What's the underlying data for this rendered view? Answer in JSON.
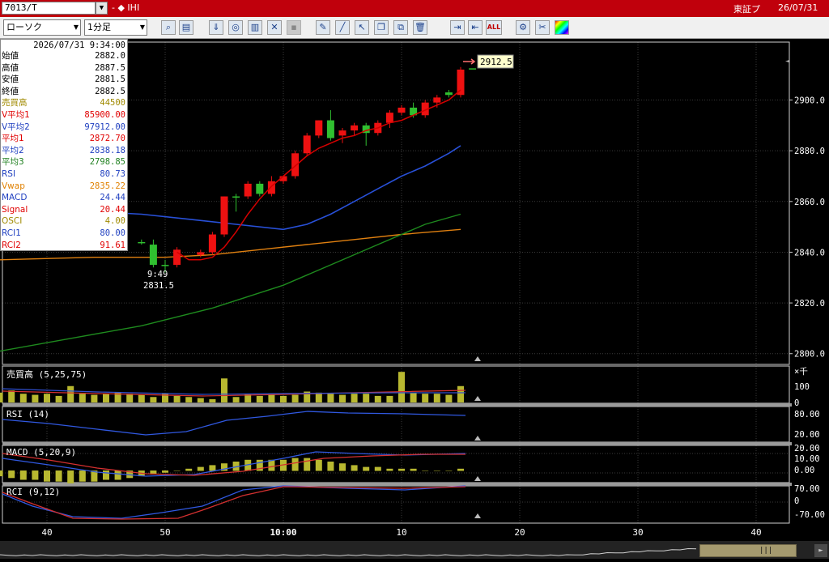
{
  "titlebar": {
    "symbol": "7013/T",
    "symbol_dropdown_arrow": "▼",
    "name": "- ◆ IHI",
    "exchange": "東証プ",
    "date": "26/07/31"
  },
  "toolbar": {
    "chart_type": "ローソク",
    "interval": "1分足",
    "dropdown_arrow": "▼",
    "icons": [
      "zoom-icon",
      "layout-icon",
      "download-icon",
      "search-doc-icon",
      "bar-chart-icon",
      "indicator-icon",
      "disabled-icon",
      "pencil-icon",
      "draw-line-icon",
      "cursor-icon",
      "window-icon",
      "copy-icon",
      "trash-icon",
      "scale-in-icon",
      "scale-out-icon",
      "all-icon",
      "settings-icon",
      "tools-icon",
      "color-icon"
    ],
    "all_label": "ALL"
  },
  "info_panel": {
    "timestamp": "2026/07/31  9:34:00",
    "rows": [
      {
        "label": "始値",
        "value": "2882.0",
        "color": "#000000"
      },
      {
        "label": "高値",
        "value": "2887.5",
        "color": "#000000"
      },
      {
        "label": "安値",
        "value": "2881.5",
        "color": "#000000"
      },
      {
        "label": "終値",
        "value": "2882.5",
        "color": "#000000"
      },
      {
        "label": "売買高",
        "value": "44500",
        "color": "#a08a00"
      },
      {
        "label": "V平均1",
        "value": "85900.00",
        "color": "#e00000"
      },
      {
        "label": "V平均2",
        "value": "97912.00",
        "color": "#2040c0"
      },
      {
        "label": "平均1",
        "value": "2872.70",
        "color": "#e00000"
      },
      {
        "label": "平均2",
        "value": "2838.18",
        "color": "#2040c0"
      },
      {
        "label": "平均3",
        "value": "2798.85",
        "color": "#208020"
      },
      {
        "label": "RSI",
        "value": "80.73",
        "color": "#2040c0"
      },
      {
        "label": "Vwap",
        "value": "2835.22",
        "color": "#e08000"
      },
      {
        "label": "MACD",
        "value": "24.44",
        "color": "#2040c0"
      },
      {
        "label": "Signal",
        "value": "20.44",
        "color": "#e00000"
      },
      {
        "label": "OSCI",
        "value": "4.00",
        "color": "#a08a00"
      },
      {
        "label": "RCI1",
        "value": "80.00",
        "color": "#2040c0"
      },
      {
        "label": "RCI2",
        "value": "91.61",
        "color": "#e00000"
      }
    ]
  },
  "chart_data": {
    "type": "candlestick",
    "price_axis": {
      "ticks": [
        2900,
        2880,
        2860,
        2840,
        2820,
        2800
      ],
      "tick_labels": [
        "2900.0",
        "2880.0",
        "2860.0",
        "2840.0",
        "2820.0",
        "2800.0"
      ],
      "range": [
        2798,
        2919
      ]
    },
    "time_axis": {
      "labels": [
        "40",
        "50",
        "10:00",
        "10",
        "20",
        "30",
        "40"
      ],
      "minutes": [
        -20,
        -10,
        0,
        10,
        20,
        30,
        40
      ],
      "range": [
        -24.3,
        40.4
      ]
    },
    "candles": [
      {
        "t": -12,
        "o": 2844,
        "h": 2845,
        "l": 2843,
        "c": 2844
      },
      {
        "t": -11,
        "o": 2843,
        "h": 2845,
        "l": 2834,
        "c": 2835
      },
      {
        "t": -10,
        "o": 2835,
        "h": 2837,
        "l": 2832,
        "c": 2835
      },
      {
        "t": -9,
        "o": 2835,
        "h": 2842,
        "l": 2834,
        "c": 2841
      },
      {
        "t": -7,
        "o": 2839,
        "h": 2841,
        "l": 2838,
        "c": 2840
      },
      {
        "t": -6,
        "o": 2840,
        "h": 2848,
        "l": 2839,
        "c": 2847
      },
      {
        "t": -5,
        "o": 2847,
        "h": 2862,
        "l": 2846,
        "c": 2862
      },
      {
        "t": -4,
        "o": 2862,
        "h": 2863,
        "l": 2856,
        "c": 2862
      },
      {
        "t": -3,
        "o": 2862,
        "h": 2868,
        "l": 2861,
        "c": 2867
      },
      {
        "t": -2,
        "o": 2867,
        "h": 2868,
        "l": 2862,
        "c": 2863
      },
      {
        "t": -1,
        "o": 2863,
        "h": 2870,
        "l": 2862,
        "c": 2868
      },
      {
        "t": 0,
        "o": 2868,
        "h": 2870,
        "l": 2867,
        "c": 2870
      },
      {
        "t": 1,
        "o": 2870,
        "h": 2880,
        "l": 2869,
        "c": 2879
      },
      {
        "t": 2,
        "o": 2879,
        "h": 2887,
        "l": 2878,
        "c": 2886
      },
      {
        "t": 3,
        "o": 2886,
        "h": 2892,
        "l": 2885,
        "c": 2892
      },
      {
        "t": 4,
        "o": 2892,
        "h": 2896,
        "l": 2884,
        "c": 2885
      },
      {
        "t": 5,
        "o": 2886,
        "h": 2889,
        "l": 2883,
        "c": 2888
      },
      {
        "t": 6,
        "o": 2888,
        "h": 2891,
        "l": 2886,
        "c": 2890
      },
      {
        "t": 7,
        "o": 2890,
        "h": 2891,
        "l": 2882,
        "c": 2887
      },
      {
        "t": 8,
        "o": 2887,
        "h": 2892,
        "l": 2886,
        "c": 2891
      },
      {
        "t": 9,
        "o": 2891,
        "h": 2896,
        "l": 2889,
        "c": 2895
      },
      {
        "t": 10,
        "o": 2895,
        "h": 2898,
        "l": 2894,
        "c": 2897
      },
      {
        "t": 11,
        "o": 2897,
        "h": 2899,
        "l": 2893,
        "c": 2894
      },
      {
        "t": 12,
        "o": 2894,
        "h": 2900,
        "l": 2893,
        "c": 2899
      },
      {
        "t": 13,
        "o": 2899,
        "h": 2902,
        "l": 2897,
        "c": 2901
      },
      {
        "t": 14,
        "o": 2903,
        "h": 2904,
        "l": 2901,
        "c": 2902
      },
      {
        "t": 15,
        "o": 2902,
        "h": 2913,
        "l": 2901,
        "c": 2912
      },
      {
        "t": 16,
        "o": 2912.5,
        "h": 2912.5,
        "l": 2912.5,
        "c": 2912.5
      }
    ],
    "ma1": {
      "color": "#d40000",
      "t": [
        -9,
        -8,
        -7,
        -6,
        -5,
        -4,
        -3,
        -2,
        -1,
        0,
        1,
        2,
        3,
        4,
        5,
        6,
        7,
        8,
        9,
        10,
        11,
        12,
        13,
        14,
        15
      ],
      "v": [
        2840,
        2837,
        2837,
        2838,
        2842,
        2848,
        2855,
        2861,
        2866,
        2870,
        2874,
        2878,
        2881,
        2883,
        2885,
        2886,
        2888,
        2889,
        2891,
        2892,
        2894,
        2896,
        2898,
        2900,
        2904
      ]
    },
    "ma2": {
      "color": "#2850d8",
      "t": [
        -24,
        -20,
        -16,
        -12,
        -8,
        -4,
        0,
        2,
        4,
        6,
        8,
        10,
        12,
        14,
        15
      ],
      "v": [
        2854,
        2855,
        2856,
        2855,
        2853,
        2851,
        2849,
        2851,
        2855,
        2860,
        2865,
        2870,
        2874,
        2879,
        2882
      ]
    },
    "ma3": {
      "color": "#1e8a1e",
      "t": [
        -24,
        -18,
        -12,
        -6,
        0,
        4,
        8,
        12,
        15
      ],
      "v": [
        2801,
        2806,
        2811,
        2818,
        2827,
        2835,
        2843,
        2851,
        2855
      ]
    },
    "vwap": {
      "color": "#e08010",
      "t": [
        -24,
        -16,
        -10,
        -6,
        -2,
        2,
        6,
        10,
        15
      ],
      "v": [
        2837,
        2838,
        2838,
        2839,
        2841,
        2843,
        2845,
        2847,
        2849
      ]
    },
    "price_marker": {
      "value": "2912.5"
    },
    "low_marker": {
      "time": "9:49",
      "price": "2831.5"
    },
    "volume": {
      "title": "売買高 (5,25,75)",
      "unit": "×千",
      "axis": [
        "100",
        "0"
      ],
      "t": [
        -24,
        -23,
        -22,
        -21,
        -20,
        -19,
        -18,
        -17,
        -16,
        -15,
        -14,
        -13,
        -12,
        -11,
        -10,
        -9,
        -8,
        -7,
        -6,
        -5,
        -4,
        -3,
        -2,
        -1,
        0,
        1,
        2,
        3,
        4,
        5,
        6,
        7,
        8,
        9,
        10,
        11,
        12,
        13,
        14,
        15
      ],
      "v": [
        45,
        55,
        40,
        35,
        40,
        30,
        75,
        40,
        35,
        40,
        45,
        40,
        35,
        25,
        40,
        30,
        25,
        20,
        15,
        110,
        25,
        40,
        30,
        40,
        30,
        35,
        50,
        45,
        40,
        35,
        40,
        40,
        30,
        30,
        140,
        45,
        40,
        40,
        35,
        75
      ]
    },
    "rsi": {
      "title": "RSI (14)",
      "axis": [
        "80.00",
        "20.00"
      ]
    },
    "macd": {
      "title": "MACD (5,20,9)",
      "axis": [
        "20.00",
        "10.00",
        "0.00"
      ]
    },
    "rci": {
      "title": "RCI (9,12)",
      "axis": [
        "70.00",
        "0",
        "-70.00"
      ]
    }
  }
}
